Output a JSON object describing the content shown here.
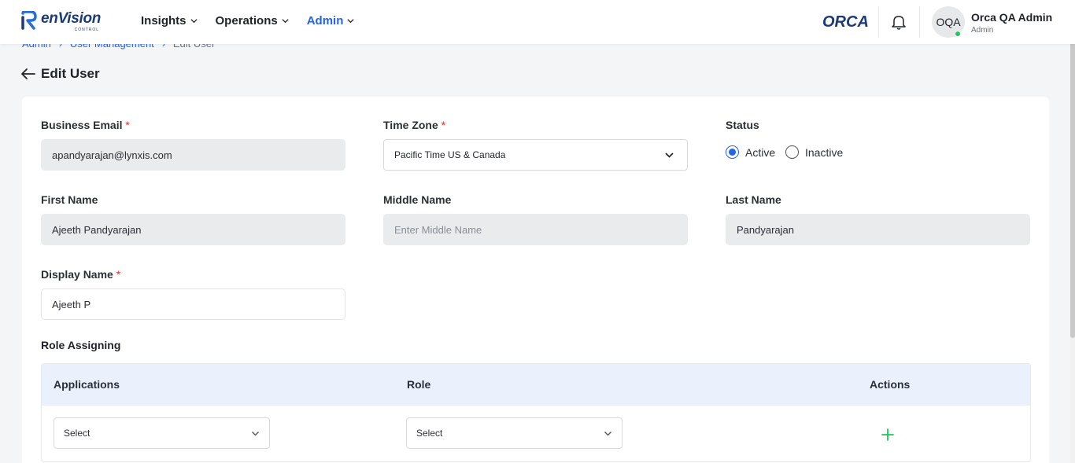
{
  "header": {
    "logo": {
      "word": "enVision",
      "sub": "CONTROL"
    },
    "nav": [
      {
        "label": "Insights",
        "active": false
      },
      {
        "label": "Operations",
        "active": false
      },
      {
        "label": "Admin",
        "active": true
      }
    ],
    "brand": "ORCA",
    "user": {
      "initials": "OQA",
      "name": "Orca QA Admin",
      "role": "Admin",
      "online": true
    }
  },
  "breadcrumb": {
    "items": [
      "Admin",
      "User Management"
    ],
    "current": "Edit User"
  },
  "page": {
    "title": "Edit User"
  },
  "form": {
    "business_email": {
      "label": "Business Email",
      "required_mark": "*",
      "value": "apandyarajan@lynxis.com"
    },
    "time_zone": {
      "label": "Time Zone",
      "required_mark": "*",
      "value": "Pacific Time US & Canada"
    },
    "status": {
      "label": "Status",
      "options": [
        "Active",
        "Inactive"
      ],
      "selected": "Active"
    },
    "first_name": {
      "label": "First Name",
      "value": "Ajeeth Pandyarajan"
    },
    "middle_name": {
      "label": "Middle Name",
      "value": "",
      "placeholder": "Enter Middle Name"
    },
    "last_name": {
      "label": "Last Name",
      "value": "Pandyarajan"
    },
    "display_name": {
      "label": "Display Name",
      "required_mark": "*",
      "value": "Ajeeth P"
    }
  },
  "role_assigning": {
    "title": "Role Assigning",
    "columns": [
      "Applications",
      "Role",
      "Actions"
    ],
    "row": {
      "application": "Select",
      "role": "Select"
    }
  },
  "colors": {
    "accent": "#2563eb",
    "required": "#e03131",
    "online": "#22c55e",
    "add": "#22c55e",
    "table_header_bg": "#eaf1fd"
  }
}
